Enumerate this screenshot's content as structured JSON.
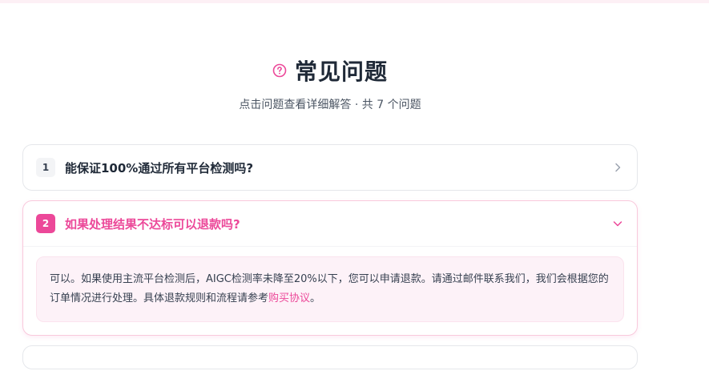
{
  "header": {
    "title": "常见问题",
    "subtitle": "点击问题查看详细解答 · 共 7 个问题"
  },
  "faq": {
    "items": [
      {
        "number": "1",
        "question": "能保证100%通过所有平台检测吗?",
        "expanded": false
      },
      {
        "number": "2",
        "question": "如果处理结果不达标可以退款吗?",
        "expanded": true,
        "answer_text": "可以。如果使用主流平台检测后，AIGC检测率未降至20%以下，您可以申请退款。请通过邮件联系我们，我们会根据您的订单情况进行处理。具体退款规则和流程请参考",
        "answer_link": "购买协议",
        "answer_end": "。"
      }
    ]
  },
  "colors": {
    "accent": "#ec4899",
    "answer_bg": "#fdf2f8"
  },
  "icons": {
    "title_icon": "question-circle-icon",
    "collapsed_icon": "chevron-right-icon",
    "expanded_icon": "chevron-down-icon"
  }
}
